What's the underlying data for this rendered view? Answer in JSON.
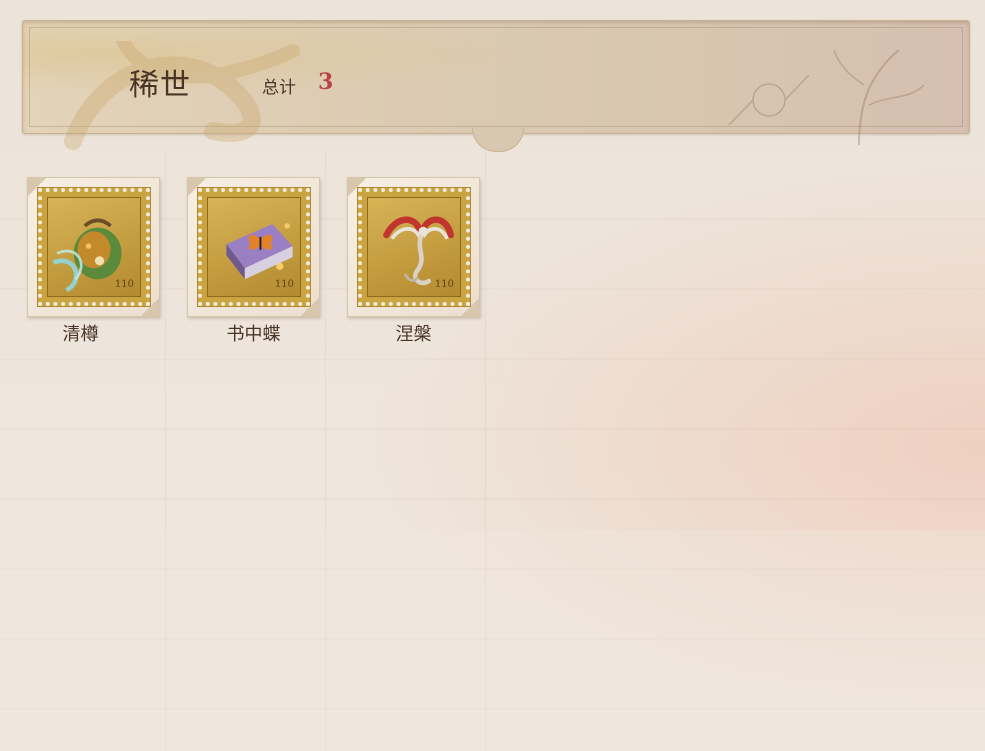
{
  "header": {
    "title": "稀世",
    "total_label": "总计",
    "total_value": "3"
  },
  "items": [
    {
      "name": "清樽",
      "icon": "vase-icon"
    },
    {
      "name": "书中蝶",
      "icon": "book-butterfly-icon"
    },
    {
      "name": "涅槃",
      "icon": "phoenix-icon"
    }
  ],
  "colors": {
    "title_text": "#4a3426",
    "total_value": "#b8434a",
    "stamp_gold": "#c9a441"
  }
}
